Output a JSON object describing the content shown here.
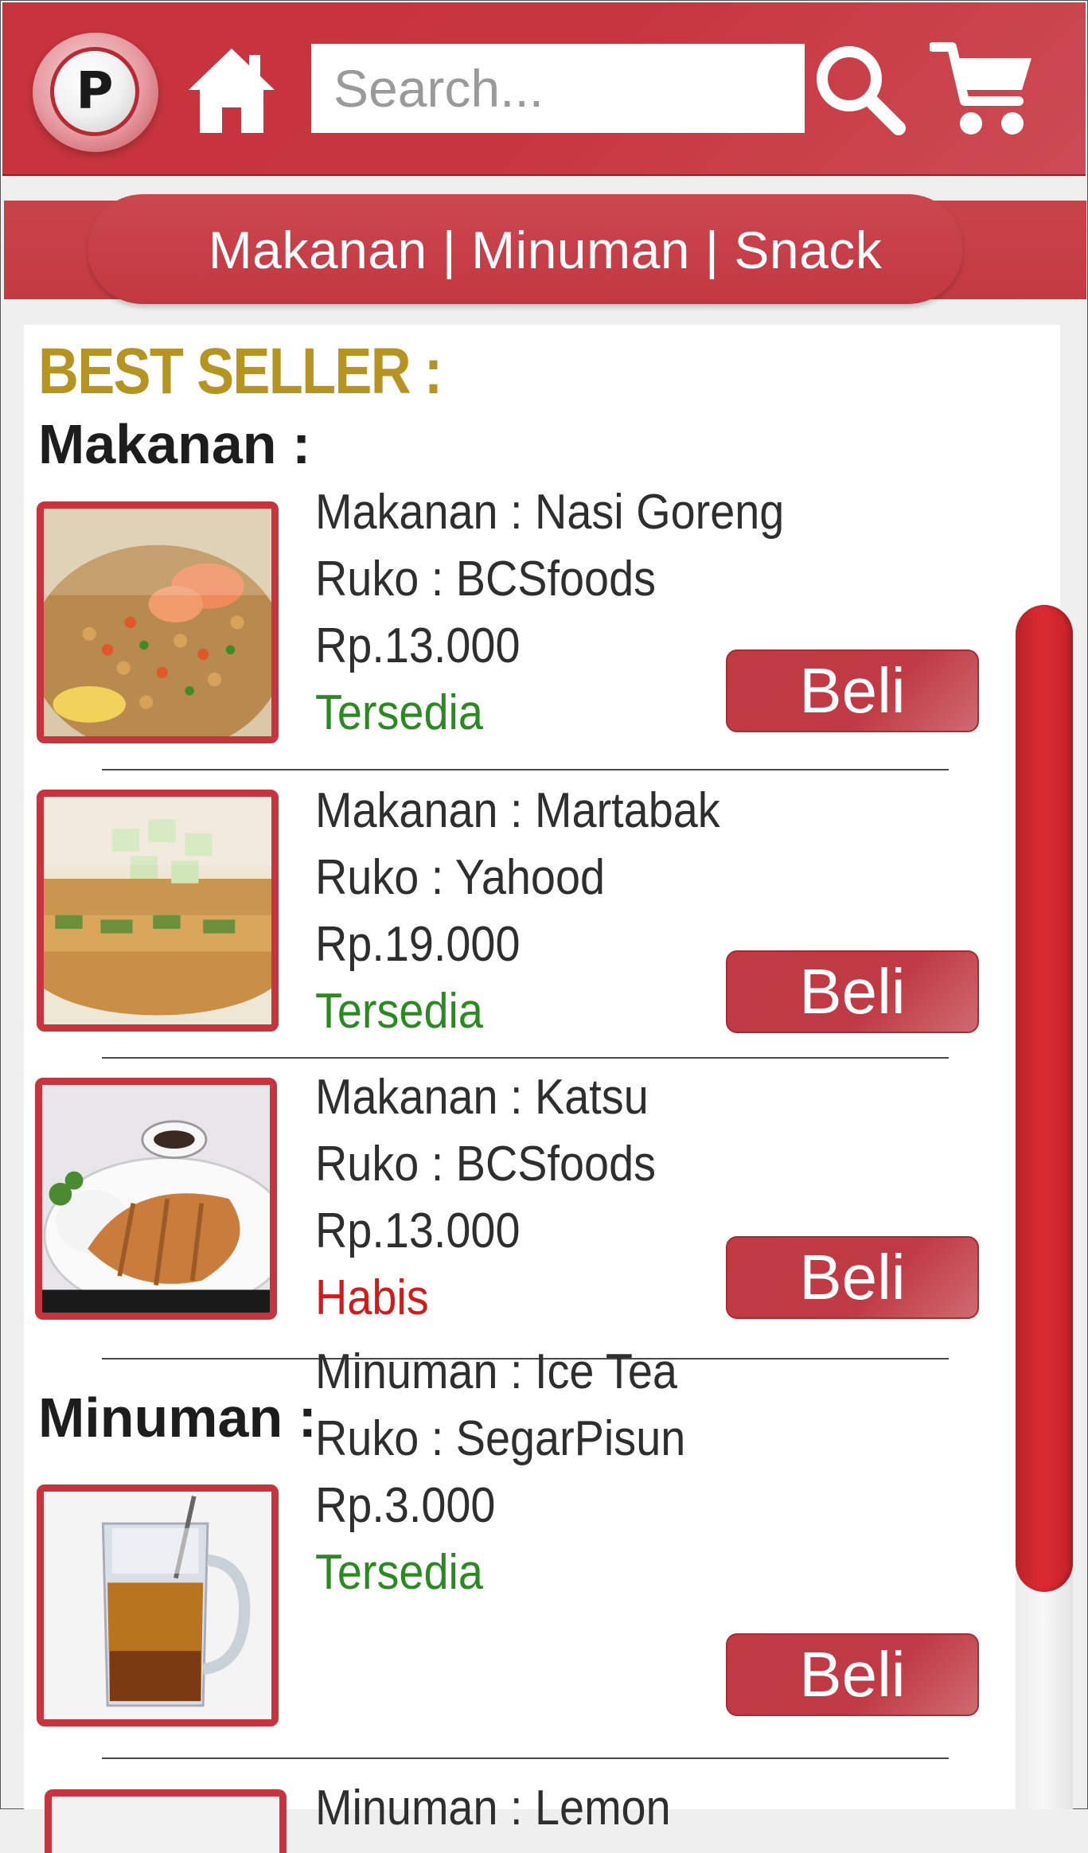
{
  "header": {
    "logo_letter": "P",
    "search_placeholder": "Search..."
  },
  "categories": {
    "items": [
      "Makanan",
      "Minuman",
      "Snack"
    ],
    "separator": "|"
  },
  "best_seller_title": "BEST SELLER :",
  "sections": [
    {
      "title": "Makanan :",
      "products": [
        {
          "name": "Makanan : Nasi Goreng",
          "store": "Ruko : BCSfoods",
          "price": "Rp.13.000",
          "status": "Tersedia",
          "button": "Beli"
        },
        {
          "name": "Makanan : Martabak",
          "store": "Ruko : Yahood",
          "price": "Rp.19.000",
          "status": "Tersedia",
          "button": "Beli"
        },
        {
          "name": "Makanan : Katsu",
          "store": "Ruko : BCSfoods",
          "price": "Rp.13.000",
          "status": "Habis",
          "button": "Beli"
        }
      ]
    },
    {
      "title": "Minuman :",
      "products": [
        {
          "name": "Minuman : Ice Tea",
          "store": "Ruko : SegarPisun",
          "price": "Rp.3.000",
          "status": "Tersedia",
          "button": "Beli"
        },
        {
          "name": "Minuman : Lemon",
          "store": "",
          "price": "",
          "status": "",
          "button": ""
        }
      ]
    }
  ],
  "colors": {
    "brand_red": "#c8343d",
    "available_green": "#2a8a1f",
    "sold_out_red": "#d11b1b",
    "best_seller_gold": "#b59422"
  }
}
